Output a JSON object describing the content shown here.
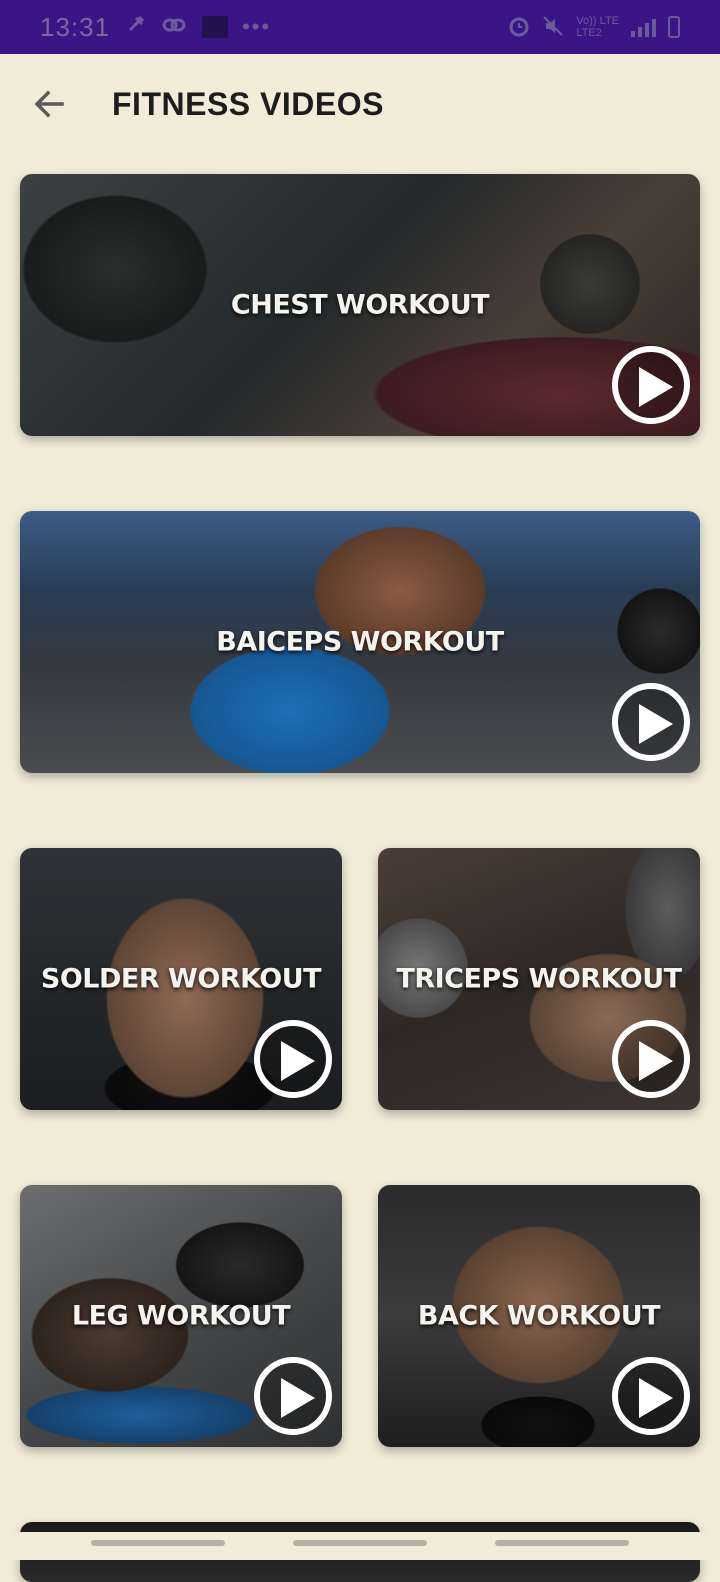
{
  "status_bar": {
    "time": "13:31",
    "network_label": "LTE",
    "network_label_2": "LTE2",
    "carrier_label": "Vo))",
    "icons": [
      "settings-icon",
      "link-icon",
      "media-icon",
      "more-icon",
      "alarm-icon",
      "mute-icon",
      "signal-icon",
      "battery-icon"
    ]
  },
  "header": {
    "title": "FITNESS VIDEOS",
    "back_icon": "arrow-back-icon"
  },
  "workouts": [
    {
      "label": "CHEST WORKOUT"
    },
    {
      "label": "BAICEPS WORKOUT"
    },
    {
      "label": "SOLDER WORKOUT"
    },
    {
      "label": "TRICEPS WORKOUT"
    },
    {
      "label": "LEG WORKOUT"
    },
    {
      "label": "BACK WORKOUT"
    }
  ],
  "colors": {
    "status_bar": "#3b1486",
    "background": "#f1ecd8",
    "title": "#1d1d1d",
    "play_button": "#ffffff"
  }
}
